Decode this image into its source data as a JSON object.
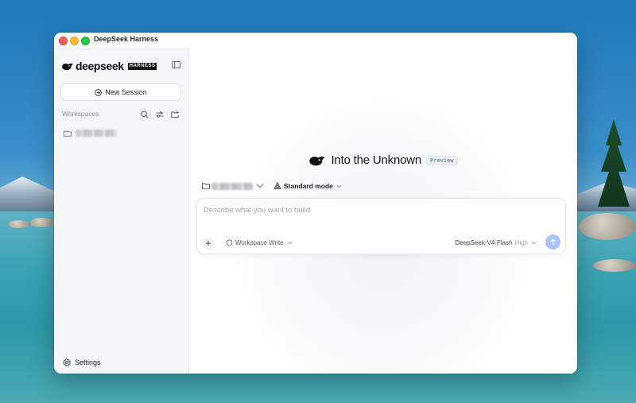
{
  "window": {
    "title": "DeepSeek Harness"
  },
  "sidebar": {
    "brand": "deepseek",
    "badge": "HARNESS",
    "new_session_label": "New Session",
    "workspaces_header": "Workspaces",
    "settings_label": "Settings"
  },
  "main": {
    "hero_title": "Into the Unknown",
    "hero_badge": "Preview",
    "mode_label": "Standard mode",
    "composer": {
      "placeholder": "Describe what you want to build",
      "permission_label": "Workspace Write",
      "model_label": "DeepSeek-V4-Flash",
      "effort_label": "High"
    }
  },
  "colors": {
    "accent": "#a9c4f5",
    "close": "#ff5f57",
    "minimize": "#febc2e",
    "zoom": "#28c840"
  },
  "icons": [
    "whale-logo-icon",
    "sidebar-toggle-icon",
    "new-session-icon",
    "search-icon",
    "filter-icon",
    "new-folder-icon",
    "folder-icon",
    "settings-gear-icon",
    "chevron-down-icon",
    "mode-icon",
    "plus-icon",
    "shield-icon",
    "send-arrow-icon"
  ]
}
